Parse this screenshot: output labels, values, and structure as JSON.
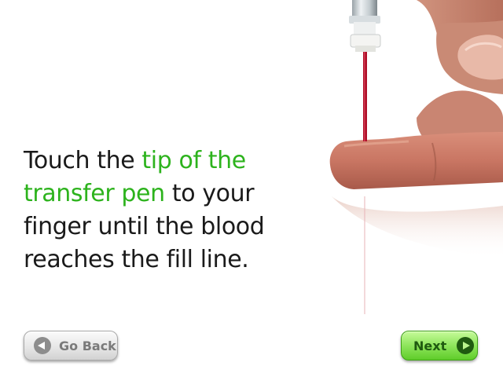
{
  "instruction": {
    "part1": "Touch the ",
    "highlight": "tip of the transfer pen",
    "part2": " to your finger until the blood reaches the fill line."
  },
  "image": {
    "description_icon": "finger-with-transfer-pen-image"
  },
  "nav": {
    "back_label": "Go Back",
    "next_label": "Next"
  },
  "colors": {
    "highlight": "#2db31d",
    "next_button": "#8ee55c",
    "back_button": "#e7e7e7",
    "blood": "#b0102a"
  }
}
